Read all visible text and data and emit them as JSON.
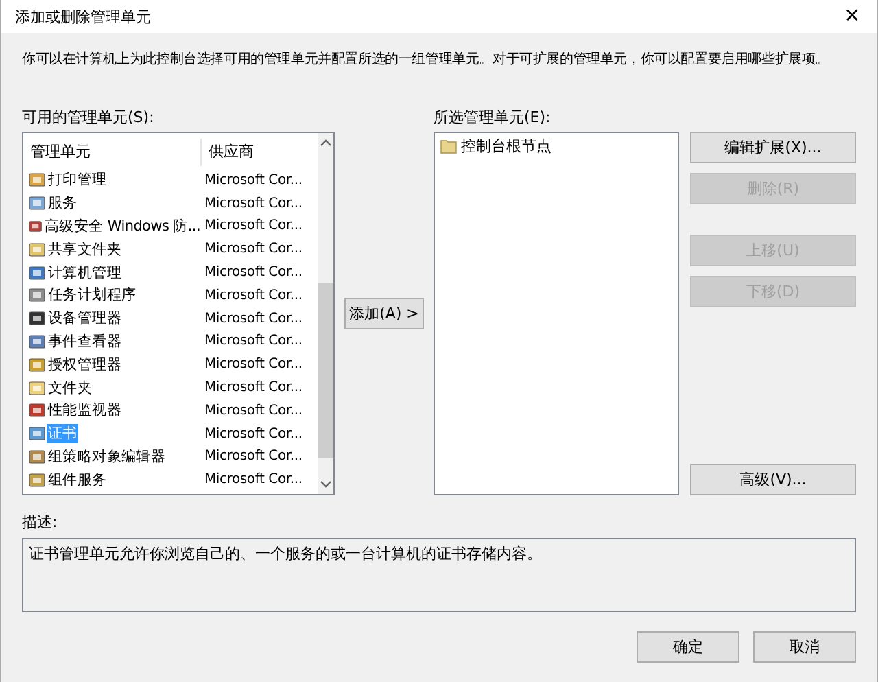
{
  "window": {
    "title": "添加或删除管理单元",
    "close": "✕"
  },
  "intro": "你可以在计算机上为此控制台选择可用的管理单元并配置所选的一组管理单元。对于可扩展的管理单元，你可以配置要启用哪些扩展项。",
  "available": {
    "label": "可用的管理单元(S):",
    "columns": [
      "管理单元",
      "供应商"
    ],
    "rows": [
      {
        "name": "打印管理",
        "vendor": "Microsoft Cor...",
        "selected": false
      },
      {
        "name": "服务",
        "vendor": "Microsoft Cor...",
        "selected": false
      },
      {
        "name": "高级安全 Windows 防...",
        "vendor": "Microsoft Cor...",
        "selected": false
      },
      {
        "name": "共享文件夹",
        "vendor": "Microsoft Cor...",
        "selected": false
      },
      {
        "name": "计算机管理",
        "vendor": "Microsoft Cor...",
        "selected": false
      },
      {
        "name": "任务计划程序",
        "vendor": "Microsoft Cor...",
        "selected": false
      },
      {
        "name": "设备管理器",
        "vendor": "Microsoft Cor...",
        "selected": false
      },
      {
        "name": "事件查看器",
        "vendor": "Microsoft Cor...",
        "selected": false
      },
      {
        "name": "授权管理器",
        "vendor": "Microsoft Cor...",
        "selected": false
      },
      {
        "name": "文件夹",
        "vendor": "Microsoft Cor...",
        "selected": false
      },
      {
        "name": "性能监视器",
        "vendor": "Microsoft Cor...",
        "selected": false
      },
      {
        "name": "证书",
        "vendor": "Microsoft Cor...",
        "selected": true
      },
      {
        "name": "组策略对象编辑器",
        "vendor": "Microsoft Cor...",
        "selected": false
      },
      {
        "name": "组件服务",
        "vendor": "Microsoft Cor...",
        "selected": false
      }
    ]
  },
  "add_button": {
    "label": "添加(A) >",
    "disabled": false
  },
  "selected_snapins": {
    "label": "所选管理单元(E):",
    "items": [
      "控制台根节点"
    ]
  },
  "side_buttons": [
    {
      "label": "编辑扩展(X)...",
      "disabled": false
    },
    {
      "label": "删除(R)",
      "disabled": true
    },
    {
      "label": "上移(U)",
      "disabled": true
    },
    {
      "label": "下移(D)",
      "disabled": true
    },
    {
      "label": "高级(V)...",
      "disabled": false
    }
  ],
  "description": {
    "label": "描述:",
    "text": "证书管理单元允许你浏览自己的、一个服务的或一台计算机的证书存储内容。"
  },
  "footer_buttons": [
    {
      "label": "确定",
      "disabled": false
    },
    {
      "label": "取消",
      "disabled": false
    }
  ]
}
